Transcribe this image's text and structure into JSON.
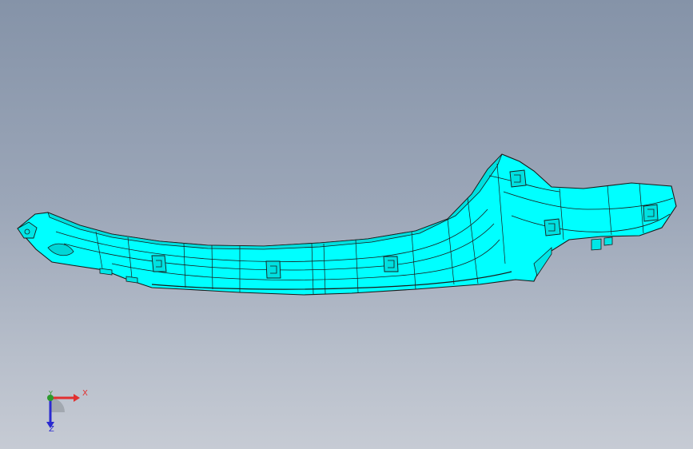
{
  "viewport": {
    "background_top": "#8593a8",
    "background_bottom": "#c6cbd4"
  },
  "part": {
    "fill_color": "#00ffff",
    "edge_color": "#1a1a1a",
    "shade_color": "#00cccc"
  },
  "triad": {
    "x_label": "X",
    "y_label": "Y",
    "z_label": "Z",
    "x_color": "#e23030",
    "y_color": "#2d9a2d",
    "z_color": "#2a2ad0"
  }
}
